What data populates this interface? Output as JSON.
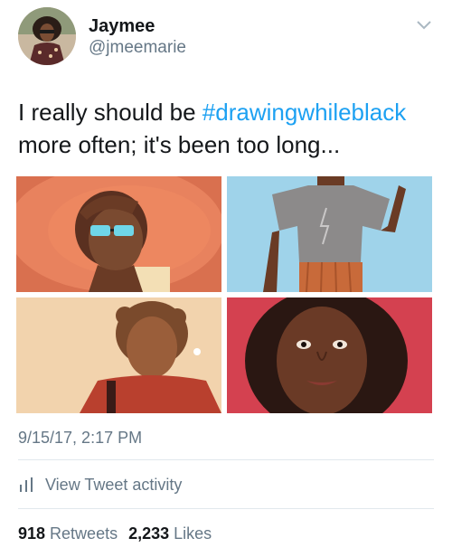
{
  "tweet": {
    "display_name": "Jaymee",
    "handle": "@jmeemarie",
    "text_part1": "I really should be ",
    "hashtag": "#drawingwhileblack",
    "text_part2": " more often; it's been too long...",
    "timestamp": "9/15/17, 2:17 PM"
  },
  "actions": {
    "view_activity": "View Tweet activity"
  },
  "stats": {
    "retweets_count": "918",
    "retweets_label": "Retweets",
    "likes_count": "2,233",
    "likes_label": "Likes"
  },
  "colors": {
    "hashtag": "#1da1f2",
    "secondary_text": "#657786",
    "primary_text": "#14171a",
    "divider": "#e1e8ed"
  },
  "icons": {
    "menu": "chevron-down-icon",
    "activity": "bar-chart-icon"
  }
}
